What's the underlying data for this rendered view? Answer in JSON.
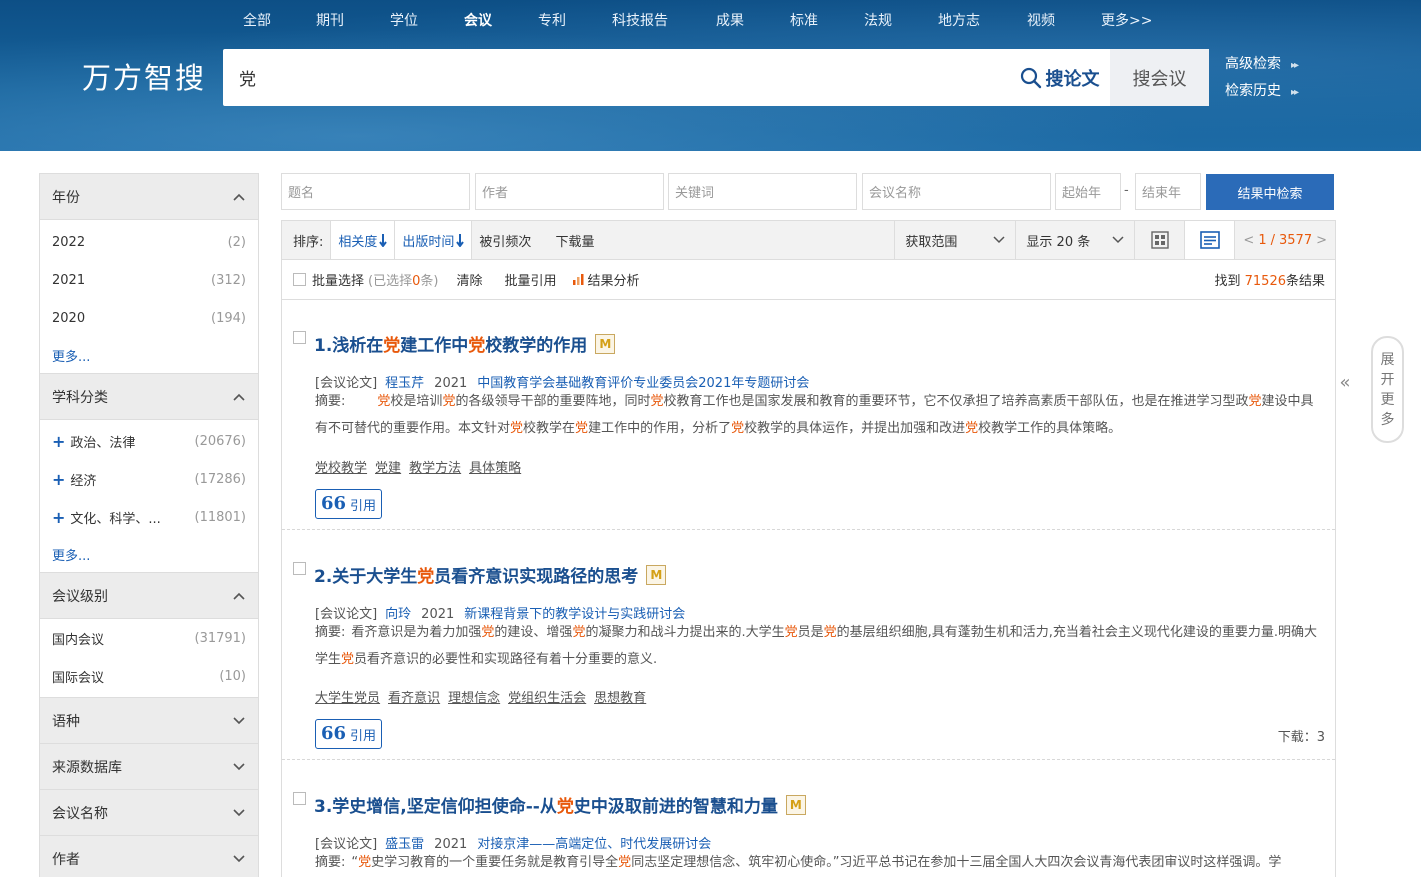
{
  "nav": {
    "items": [
      "全部",
      "期刊",
      "学位",
      "会议",
      "专利",
      "科技报告",
      "成果",
      "标准",
      "法规",
      "地方志",
      "视频",
      "更多>>"
    ],
    "active_index": 3
  },
  "logo": "万方智搜",
  "search": {
    "value": "党",
    "btn_primary": "搜论文",
    "btn_secondary": "搜会议"
  },
  "header_links": {
    "advanced": "高级检索",
    "history": "检索历史"
  },
  "sidebar": {
    "year": {
      "title": "年份",
      "items": [
        {
          "label": "2022",
          "count": "(2)"
        },
        {
          "label": "2021",
          "count": "(312)"
        },
        {
          "label": "2020",
          "count": "(194)"
        }
      ],
      "more": "更多..."
    },
    "subject": {
      "title": "学科分类",
      "items": [
        {
          "label": "政治、法律",
          "count": "(20676)"
        },
        {
          "label": "经济",
          "count": "(17286)"
        },
        {
          "label": "文化、科学、...",
          "count": "(11801)"
        }
      ],
      "more": "更多..."
    },
    "level": {
      "title": "会议级别",
      "items": [
        {
          "label": "国内会议",
          "count": "(31791)"
        },
        {
          "label": "国际会议",
          "count": "(10)"
        }
      ]
    },
    "collapsed": [
      "语种",
      "来源数据库",
      "会议名称",
      "作者"
    ]
  },
  "filters": {
    "title": "题名",
    "author": "作者",
    "keyword": "关键词",
    "conference": "会议名称",
    "start_year": "起始年",
    "sep": "-",
    "end_year": "结束年",
    "button": "结果中检索"
  },
  "sortbar": {
    "label": "排序:",
    "relevance": "相关度",
    "pubtime": "出版时间",
    "citations": "被引频次",
    "downloads": "下载量",
    "range": "获取范围",
    "show": "显示 20 条",
    "page_current": "1",
    "page_total": "3577",
    "prev": "<",
    "next": ">"
  },
  "toolbar": {
    "batch": "批量选择",
    "selected": "(已选择",
    "selected_count": "0",
    "selected_unit": "条)",
    "clear": "清除",
    "batch_cite": "批量引用",
    "analysis": "结果分析",
    "found_prefix": "找到",
    "found_count": "71526",
    "found_suffix": "条结果"
  },
  "results": [
    {
      "num": "1.",
      "title_parts": [
        "浅析在",
        "党",
        "建工作中",
        "党",
        "校教学的作用"
      ],
      "type": "[会议论文]",
      "author": "程玉芹",
      "year": "2021",
      "conference": "中国教育学会基础教育评价专业委员会2021年专题研讨会",
      "abstract_label": "摘要:",
      "abstract_parts": [
        "　　",
        "党",
        "校是培训",
        "党",
        "的各级领导干部的重要阵地，同时",
        "党",
        "校教育工作也是国家发展和教育的重要环节，它不仅承担了培养高素质干部队伍，也是在推进学习型政",
        "党",
        "建设中具有不可替代的重要作用。本文针对",
        "党",
        "校教学在",
        "党",
        "建工作中的作用，分析了",
        "党",
        "校教学的具体运作，并提出加强和改进",
        "党",
        "校教学工作的具体策略。"
      ],
      "keywords": [
        [
          "党",
          "校教学"
        ],
        [
          "党",
          "建"
        ],
        [
          "",
          "教学方法"
        ],
        [
          "",
          "具体策略"
        ]
      ],
      "cite": "引用",
      "download": ""
    },
    {
      "num": "2.",
      "title_parts": [
        "关于大学生",
        "党",
        "员看齐意识实现路径的思考"
      ],
      "type": "[会议论文]",
      "author": "向玲",
      "year": "2021",
      "conference": "新课程背景下的教学设计与实践研讨会",
      "abstract_label": "摘要:",
      "abstract_parts": [
        "看齐意识是为着力加强",
        "党",
        "的建设、增强",
        "党",
        "的凝聚力和战斗力提出来的.大学生",
        "党",
        "员是",
        "党",
        "的基层组织细胞,具有蓬勃生机和活力,充当着社会主义现代化建设的重要力量.明确大学生",
        "党",
        "员看齐意识的必要性和实现路径有着十分重要的意义."
      ],
      "keywords": [
        [
          "",
          "大学生",
          "党",
          "员"
        ],
        [
          "",
          "看齐意识"
        ],
        [
          "",
          "理想信念"
        ],
        [
          "党",
          "组织生活会"
        ],
        [
          "",
          "思想教育"
        ]
      ],
      "cite": "引用",
      "download": "下载：3"
    },
    {
      "num": "3.",
      "title_parts": [
        "学史增信,坚定信仰担使命--从",
        "党",
        "史中汲取前进的智慧和力量"
      ],
      "type": "[会议论文]",
      "author": "盛玉雷",
      "year": "2021",
      "conference": "对接京津——高端定位、时代发展研讨会",
      "abstract_label": "摘要:",
      "abstract_parts": [
        "“",
        "党",
        "史学习教育的一个重要任务就是教育引导全",
        "党",
        "同志坚定理想信念、筑牢初心使命。”习近平总书记在参加十三届全国人大四次会议青海代表团审议时这样强调。学"
      ],
      "keywords": [],
      "cite": "",
      "download": ""
    }
  ],
  "expander": [
    "展",
    "开",
    "更",
    "多"
  ],
  "collapse_icon": "«",
  "colors": {
    "accent": "#1a5fb4",
    "highlight": "#e8590c",
    "header": "#17639c"
  }
}
